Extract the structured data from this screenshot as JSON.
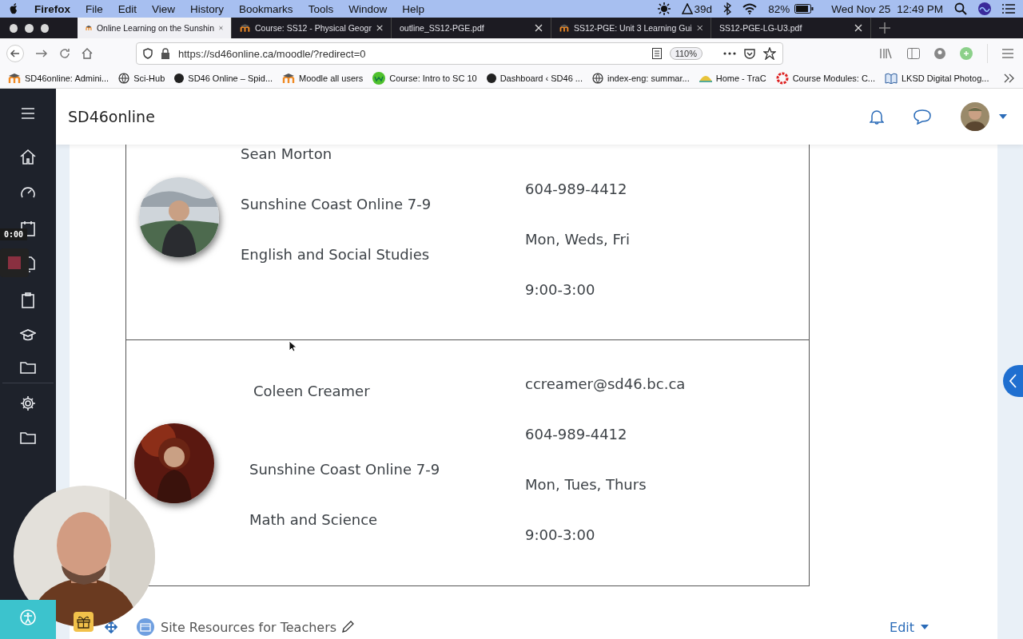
{
  "menubar": {
    "app": "Firefox",
    "menus": [
      "File",
      "Edit",
      "View",
      "History",
      "Bookmarks",
      "Tools",
      "Window",
      "Help"
    ],
    "timer": "39d",
    "battery": "82%",
    "date": "Wed Nov 25",
    "time": "12:49 PM"
  },
  "tabs": [
    {
      "title": "Online Learning on the Sunshin",
      "kind": "moodle",
      "selected": true
    },
    {
      "title": "Course: SS12 - Physical Geogr",
      "kind": "moodle",
      "selected": false
    },
    {
      "title": "outline_SS12-PGE.pdf",
      "kind": "pdf",
      "selected": false
    },
    {
      "title": "SS12-PGE: Unit 3 Learning Gui",
      "kind": "moodle",
      "selected": false
    },
    {
      "title": "SS12-PGE-LG-U3.pdf",
      "kind": "pdf",
      "selected": false
    }
  ],
  "toolbar": {
    "url": "https://sd46online.ca/moodle/?redirect=0",
    "zoom": "110%"
  },
  "bookmarks": [
    {
      "label": "SD46online: Admini...",
      "kind": "moodle"
    },
    {
      "label": "Sci-Hub",
      "kind": "globe"
    },
    {
      "label": "SD46 Online – Spid...",
      "kind": "dot"
    },
    {
      "label": "Moodle all users",
      "kind": "moodle"
    },
    {
      "label": "Course: Intro to SC 10",
      "kind": "badge"
    },
    {
      "label": "Dashboard ‹ SD46 ...",
      "kind": "dot"
    },
    {
      "label": "index-eng: summar...",
      "kind": "globe"
    },
    {
      "label": "Home - TraC",
      "kind": "trac"
    },
    {
      "label": "Course Modules: C...",
      "kind": "ring"
    },
    {
      "label": "LKSD Digital Photog...",
      "kind": "book"
    }
  ],
  "site": {
    "title": "SD46online"
  },
  "recording": {
    "time": "0:00"
  },
  "teachers": [
    {
      "name": "Sean Morton",
      "school": "Sunshine Coast Online 7-9",
      "subjects": "English and Social Studies",
      "phone": "604-989-4412",
      "days": "Mon, Weds, Fri",
      "hours": "9:00-3:00"
    },
    {
      "name": "Coleen Creamer",
      "email": "ccreamer@sd46.bc.ca",
      "school": "Sunshine Coast Online 7-9",
      "subjects": "Math and Science",
      "phone": "604-989-4412",
      "days": "Mon, Tues, Thurs",
      "hours": "9:00-3:00"
    }
  ],
  "section": {
    "title": "Site Resources for Teachers",
    "edit": "Edit"
  }
}
